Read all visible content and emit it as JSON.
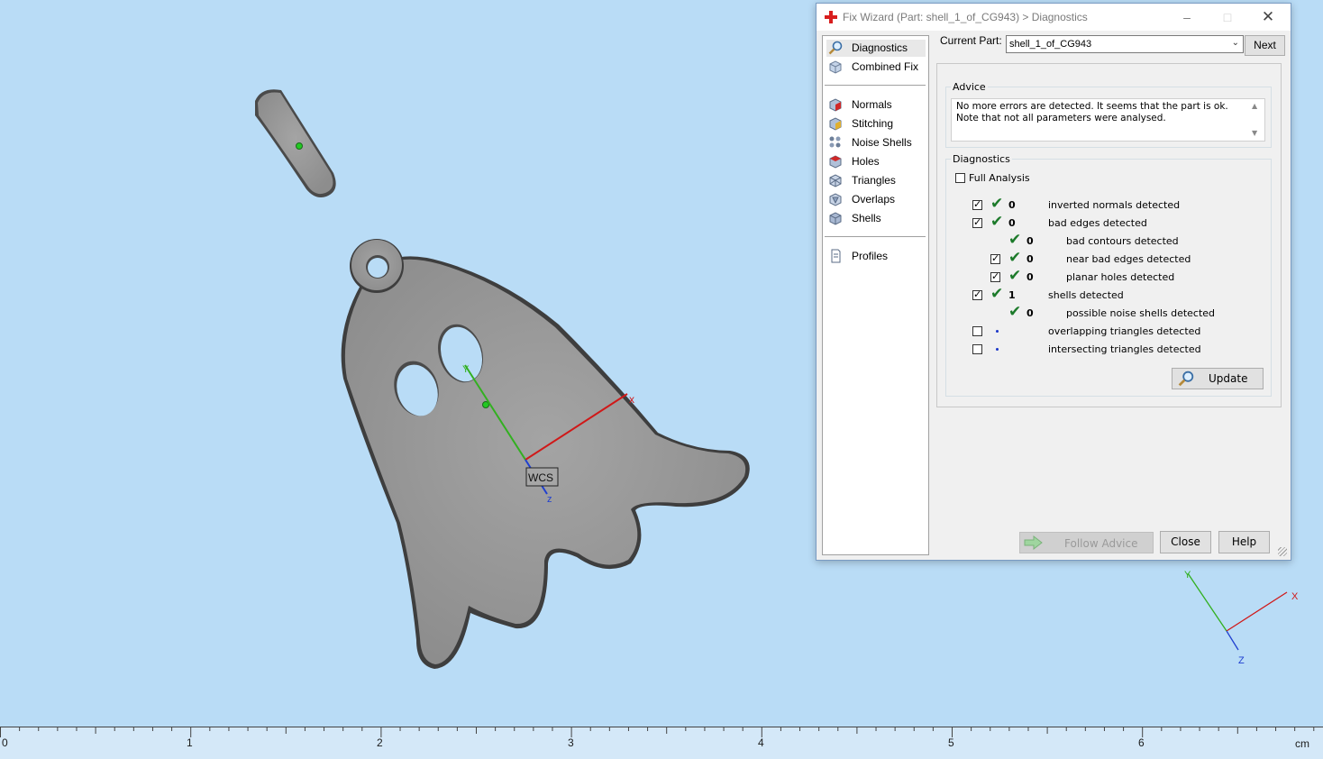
{
  "viewport": {
    "wcs_label": "WCS",
    "axis_x": "x",
    "axis_y": "Y",
    "axis_z": "z",
    "corner_axis_x": "X",
    "corner_axis_y": "Y",
    "corner_axis_z": "Z",
    "colors": {
      "background": "#b9dcf6",
      "model": "#9e9e9e",
      "x_axis": "#d01818",
      "y_axis": "#32b020",
      "z_axis": "#2040d0",
      "marker": "#22c922"
    }
  },
  "ruler": {
    "labels": [
      "0",
      "1",
      "2",
      "3",
      "4",
      "5",
      "6"
    ],
    "unit": "cm"
  },
  "dialog": {
    "title": "Fix Wizard (Part: shell_1_of_CG943) > Diagnostics",
    "nav": {
      "top": [
        {
          "label": "Diagnostics",
          "icon": "magnifier-icon"
        },
        {
          "label": "Combined Fix",
          "icon": "combined-fix-icon"
        }
      ],
      "middle": [
        {
          "label": "Normals",
          "icon": "normals-cube-icon"
        },
        {
          "label": "Stitching",
          "icon": "stitching-cube-icon"
        },
        {
          "label": "Noise Shells",
          "icon": "noise-shells-icon"
        },
        {
          "label": "Holes",
          "icon": "holes-cube-icon"
        },
        {
          "label": "Triangles",
          "icon": "triangles-cube-icon"
        },
        {
          "label": "Overlaps",
          "icon": "overlaps-cube-icon"
        },
        {
          "label": "Shells",
          "icon": "shells-cube-icon"
        }
      ],
      "bottom": [
        {
          "label": "Profiles",
          "icon": "document-icon"
        }
      ]
    },
    "current_part_label": "Current Part:",
    "current_part_value": "shell_1_of_CG943",
    "next_label": "Next",
    "advice_title": "Advice",
    "advice_text": "No more errors are detected. It seems that the part is ok. Note that not all parameters were analysed.",
    "diagnostics_title": "Diagnostics",
    "full_analysis_label": "Full Analysis",
    "full_analysis_checked": false,
    "rows": [
      {
        "checkbox": true,
        "checked": true,
        "status": "ok",
        "count": "0",
        "label": "inverted normals detected",
        "indent": 0
      },
      {
        "checkbox": true,
        "checked": true,
        "status": "ok",
        "count": "0",
        "label": "bad edges detected",
        "indent": 0
      },
      {
        "checkbox": false,
        "checked": false,
        "status": "ok",
        "count": "0",
        "label": "bad contours detected",
        "indent": 1
      },
      {
        "checkbox": true,
        "checked": true,
        "status": "ok",
        "count": "0",
        "label": "near bad edges detected",
        "indent": 1
      },
      {
        "checkbox": true,
        "checked": true,
        "status": "ok",
        "count": "0",
        "label": "planar holes detected",
        "indent": 1
      },
      {
        "checkbox": true,
        "checked": true,
        "status": "ok",
        "count": "1",
        "label": "shells detected",
        "indent": 0
      },
      {
        "checkbox": false,
        "checked": false,
        "status": "ok",
        "count": "0",
        "label": "possible noise shells detected",
        "indent": 1
      },
      {
        "checkbox": true,
        "checked": false,
        "status": "dot",
        "count": "",
        "label": "overlapping triangles detected",
        "indent": 0
      },
      {
        "checkbox": true,
        "checked": false,
        "status": "dot",
        "count": "",
        "label": "intersecting triangles detected",
        "indent": 0
      }
    ],
    "update_label": "Update",
    "follow_advice_label": "Follow Advice",
    "close_label": "Close",
    "help_label": "Help"
  }
}
